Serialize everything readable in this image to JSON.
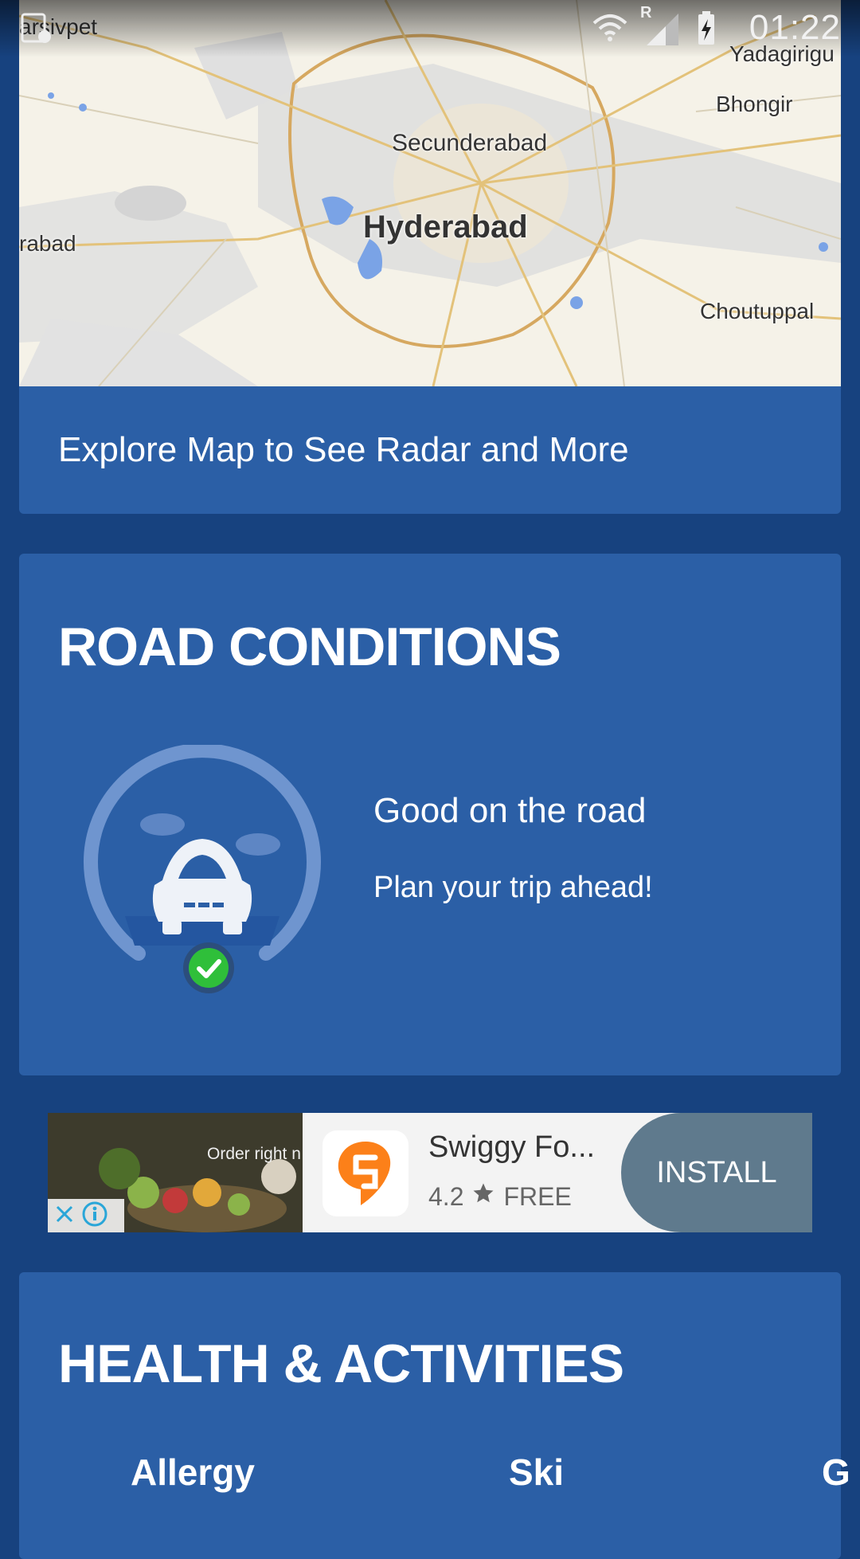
{
  "status_bar": {
    "time": "01:22",
    "network_label": "R"
  },
  "map": {
    "labels": {
      "yadagirigutta": "Yadagirigu",
      "bhongir": "Bhongir",
      "secunderabad": "Secunderabad",
      "hyderabad": "Hyderabad",
      "choutuppal": "Choutuppal",
      "abad": "rabad",
      "narsivpet": "arsivpet"
    },
    "explore_text": "Explore Map to See Radar and More"
  },
  "road_conditions": {
    "title": "ROAD CONDITIONS",
    "status": "Good on the road",
    "subtitle": "Plan your trip ahead!",
    "status_color": "#2fbf3a"
  },
  "ad": {
    "image_text": "Order right n",
    "app_name": "Swiggy Fo...",
    "rating": "4.2",
    "price": "FREE",
    "install_label": "INSTALL",
    "brand_color": "#fc8019"
  },
  "health": {
    "title": "HEALTH & ACTIVITIES",
    "activities": [
      "Allergy",
      "Ski",
      "G"
    ]
  },
  "colors": {
    "background": "#17427f",
    "card": "#2b5fa6",
    "install_button": "#5f7a8d"
  }
}
